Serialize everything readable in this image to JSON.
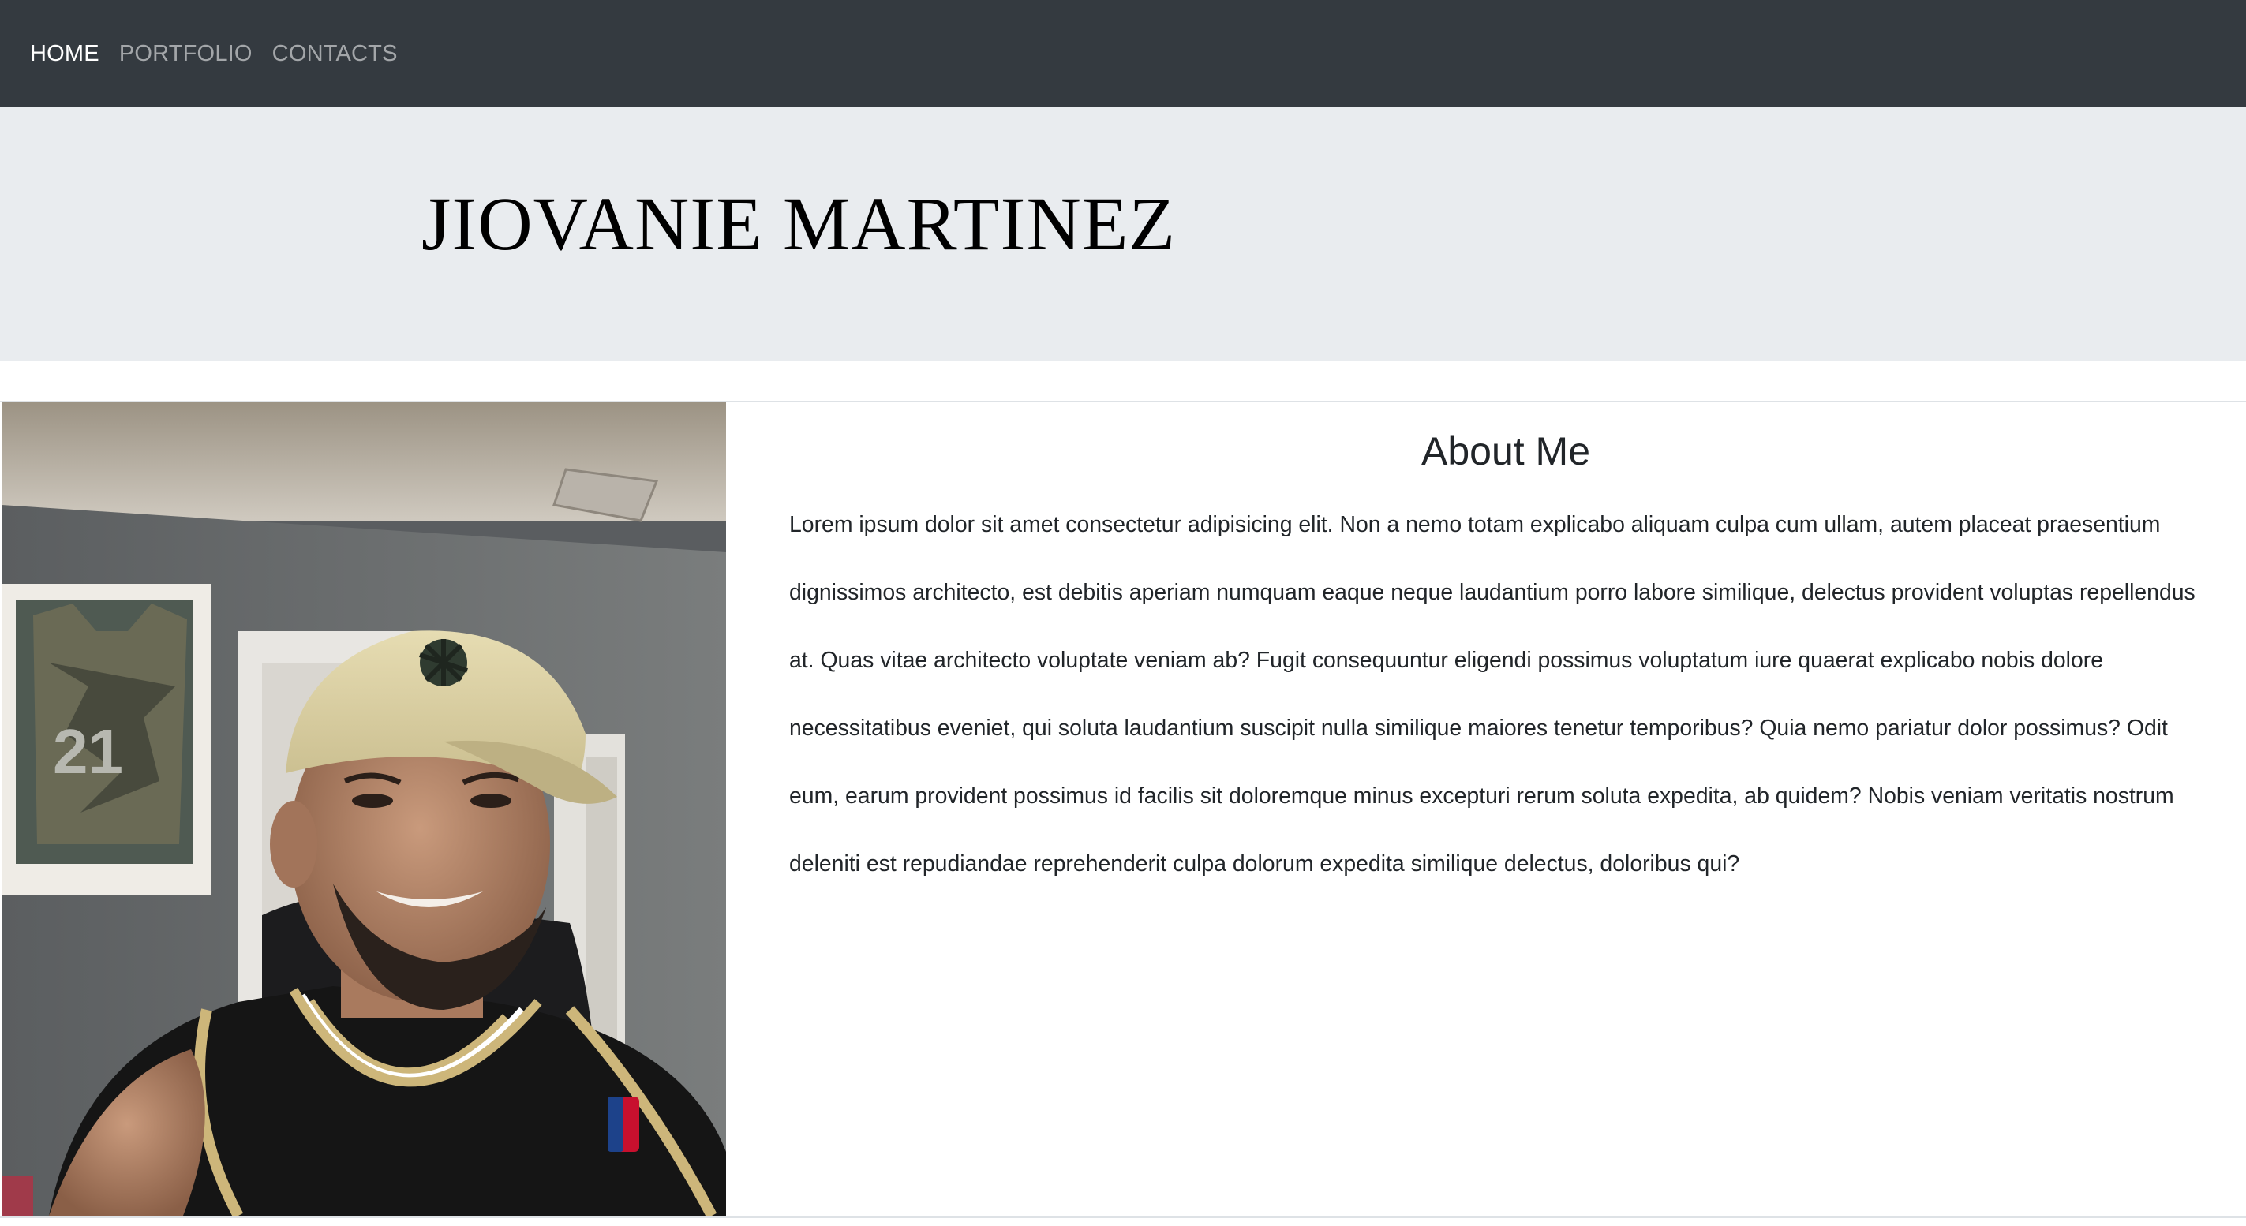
{
  "nav": {
    "items": [
      {
        "label": "HOME",
        "active": true
      },
      {
        "label": "PORTFOLIO",
        "active": false
      },
      {
        "label": "CONTACTS",
        "active": false
      }
    ]
  },
  "hero": {
    "title": "JIOVANIE MARTINEZ"
  },
  "about": {
    "heading": "About Me",
    "paragraph": "Lorem ipsum dolor sit amet consectetur adipisicing elit. Non a nemo totam explicabo aliquam culpa cum ullam, autem placeat praesentium dignissimos architecto, est debitis aperiam numquam eaque neque laudantium porro labore similique, delectus provident voluptas repellendus at. Quas vitae architecto voluptate veniam ab? Fugit consequuntur eligendi possimus voluptatum iure quaerat explicabo nobis dolore necessitatibus eveniet, qui soluta laudantium suscipit nulla similique maiores tenetur temporibus? Quia nemo pariatur dolor possimus? Odit eum, earum provident possimus id facilis sit doloremque minus excepturi rerum soluta expedita, ab quidem? Nobis veniam veritatis nostrum deleniti est repudiandae reprehenderit culpa dolorum expedita similique delectus, doloribus qui?",
    "photo_number": "21"
  },
  "colors": {
    "navbar_bg": "#343a40",
    "hero_bg": "#e9ecef"
  }
}
